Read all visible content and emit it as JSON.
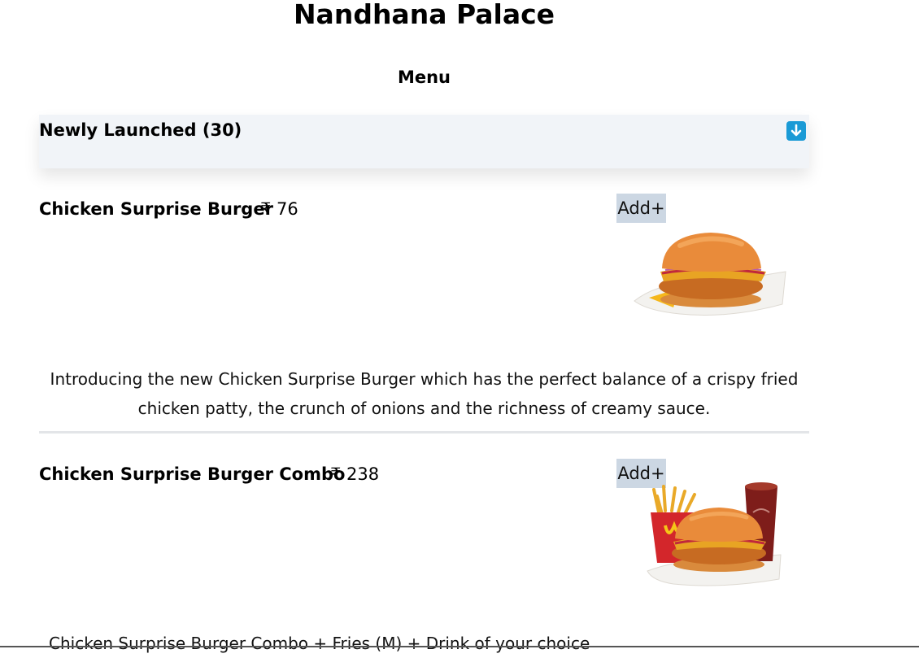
{
  "header": {
    "restaurant_name": "Nandhana Palace",
    "menu_heading": "Menu"
  },
  "category": {
    "title": "Newly Launched (30)",
    "toggle_icon": "arrow-down-icon",
    "accent_color": "#1a9ad6"
  },
  "items": [
    {
      "name": "Chicken Surprise Burger",
      "price": "₹ 76",
      "add_label": "Add+",
      "image_icon": "burger-image",
      "description": "Introducing the new Chicken Surprise Burger which has the perfect balance of a crispy fried chicken patty, the crunch of onions and the richness of creamy sauce."
    },
    {
      "name": "Chicken Surprise Burger Combo",
      "price": "₹ 238",
      "add_label": "Add+",
      "image_icon": "burger-combo-image",
      "description": "Chicken Surprise Burger Combo + Fries (M) + Drink of your choice"
    }
  ]
}
